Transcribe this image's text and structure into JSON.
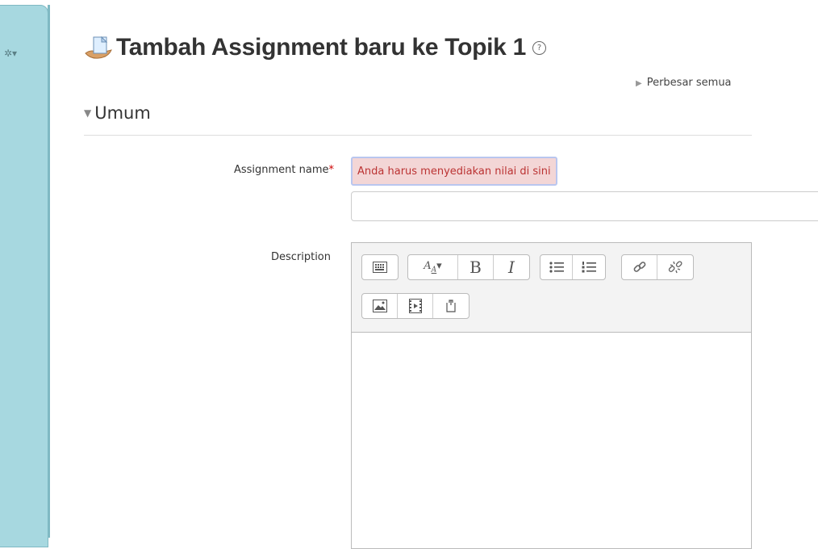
{
  "page": {
    "title": "Tambah Assignment baru ke Topik 1",
    "help_symbol": "?",
    "expand_all": "Perbesar semua"
  },
  "section": {
    "title": "Umum"
  },
  "form": {
    "assignment_name": {
      "label": "Assignment name",
      "required_mark": "*",
      "error": "Anda harus menyediakan nilai di sini",
      "value": ""
    },
    "description": {
      "label": "Description"
    }
  },
  "toolbar": {
    "bold": "B",
    "italic": "I"
  },
  "colors": {
    "side_block": "#a7d8e0",
    "error_bg": "#f3d6d6",
    "error_text": "#b33333",
    "required": "#cc0000"
  },
  "icons": [
    "gear-icon",
    "assignment-icon",
    "help-icon",
    "expand-icon",
    "collapse-caret-icon",
    "toolbar-toggle-icon",
    "font-style-icon",
    "bullet-list-icon",
    "numbered-list-icon",
    "link-icon",
    "unlink-icon",
    "image-icon",
    "media-icon",
    "manage-files-icon"
  ]
}
